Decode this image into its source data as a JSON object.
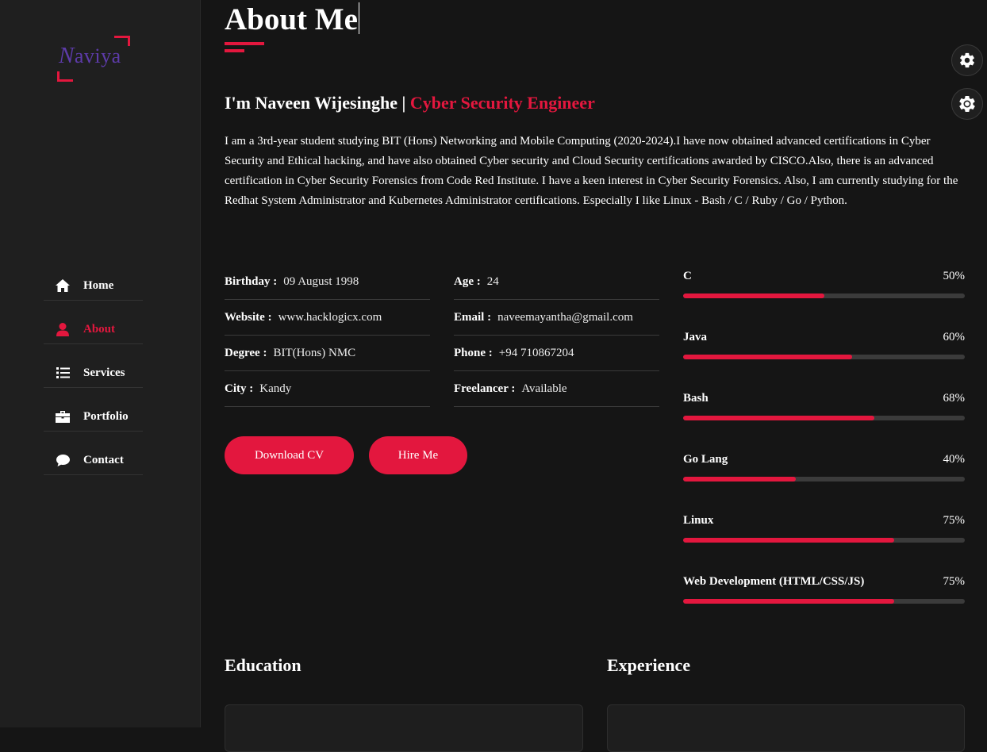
{
  "logo": {
    "initial": "N",
    "rest": "aviya"
  },
  "nav": [
    {
      "label": "Home",
      "icon": "home-icon",
      "active": false
    },
    {
      "label": "About",
      "icon": "user-icon",
      "active": true
    },
    {
      "label": "Services",
      "icon": "list-icon",
      "active": false
    },
    {
      "label": "Portfolio",
      "icon": "briefcase-icon",
      "active": false
    },
    {
      "label": "Contact",
      "icon": "chat-icon",
      "active": false
    }
  ],
  "page": {
    "title": "About Me"
  },
  "intro": {
    "prefix": "I'm Naveen Wijesinghe | ",
    "role": "Cyber Security Engineer"
  },
  "bio": "I am a 3rd-year student studying BIT (Hons) Networking and Mobile Computing (2020-2024).I have now obtained advanced certifications in Cyber Security and Ethical hacking, and have also obtained Cyber security and Cloud Security certifications awarded by CISCO.Also, there is an advanced certification in Cyber Security Forensics from Code Red Institute. I have a keen interest in Cyber Security Forensics. Also, I am currently studying for the Redhat System Administrator and Kubernetes Administrator certifications. Especially I like Linux - Bash / C / Ruby / Go / Python.",
  "info_col1": [
    {
      "key": "Birthday :",
      "value": "09 August 1998"
    },
    {
      "key": "Website :",
      "value": "www.hacklogicx.com"
    },
    {
      "key": "Degree :",
      "value": "BIT(Hons) NMC"
    },
    {
      "key": "City :",
      "value": "Kandy"
    }
  ],
  "info_col2": [
    {
      "key": "Age :",
      "value": "24"
    },
    {
      "key": "Email :",
      "value": "naveemayantha@gmail.com"
    },
    {
      "key": "Phone :",
      "value": "+94 710867204"
    },
    {
      "key": "Freelancer :",
      "value": "Available"
    }
  ],
  "buttons": {
    "download_cv": "Download CV",
    "hire_me": "Hire Me"
  },
  "skills": [
    {
      "name": "C",
      "percent_label": "50%",
      "percent": 50
    },
    {
      "name": "Java",
      "percent_label": "60%",
      "percent": 60
    },
    {
      "name": "Bash",
      "percent_label": "68%",
      "percent": 68
    },
    {
      "name": "Go Lang",
      "percent_label": "40%",
      "percent": 40
    },
    {
      "name": "Linux",
      "percent_label": "75%",
      "percent": 75
    },
    {
      "name": "Web Development (HTML/CSS/JS)",
      "percent_label": "75%",
      "percent": 75
    }
  ],
  "sections": {
    "education": "Education",
    "experience": "Experience"
  },
  "colors": {
    "accent": "#e3173e",
    "background": "#151515",
    "sidebar": "#1f1f1f",
    "logo": "#5d3ba9"
  },
  "floating_buttons": [
    {
      "icon": "gear-icon"
    },
    {
      "icon": "theme-toggle-icon"
    }
  ]
}
